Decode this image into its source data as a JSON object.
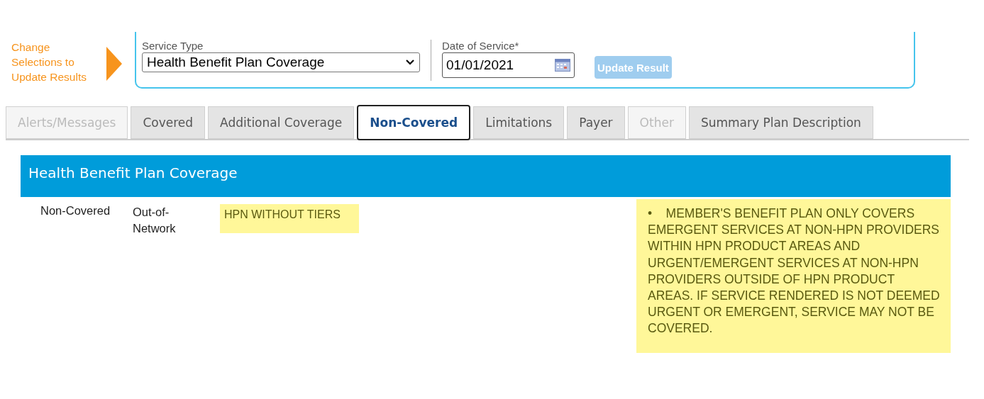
{
  "prompt": {
    "text": "Change Selections to Update Results"
  },
  "filters": {
    "service_type": {
      "label": "Service Type",
      "value": "Health Benefit Plan Coverage"
    },
    "date_of_service": {
      "label": "Date of Service*",
      "value": "01/01/2021"
    },
    "update_button": {
      "label": "Update Result",
      "disabled": true
    }
  },
  "tabs": [
    {
      "label": "Alerts/Messages",
      "selected": false,
      "disabled": true
    },
    {
      "label": "Covered",
      "selected": false,
      "disabled": false
    },
    {
      "label": "Additional Coverage",
      "selected": false,
      "disabled": false
    },
    {
      "label": "Non-Covered",
      "selected": true,
      "disabled": false
    },
    {
      "label": "Limitations",
      "selected": false,
      "disabled": false
    },
    {
      "label": "Payer",
      "selected": false,
      "disabled": false
    },
    {
      "label": "Other",
      "selected": false,
      "disabled": true
    },
    {
      "label": "Summary Plan Description",
      "selected": false,
      "disabled": false
    }
  ],
  "section": {
    "title": "Health Benefit Plan Coverage",
    "rows": [
      {
        "status": "Non-Covered",
        "network": "Out-of-Network",
        "plan": "HPN WITHOUT TIERS",
        "note": {
          "bullet": "•",
          "text": "MEMBER'S BENEFIT PLAN ONLY COVERS EMERGENT SERVICES AT NON-HPN PROVIDERS WITHIN HPN PRODUCT AREAS AND URGENT/EMERGENT SERVICES AT NON-HPN PROVIDERS OUTSIDE OF HPN PRODUCT AREAS. IF SERVICE RENDERED IS NOT DEEMED URGENT OR EMERGENT, SERVICE MAY NOT BE COVERED."
        }
      }
    ]
  }
}
